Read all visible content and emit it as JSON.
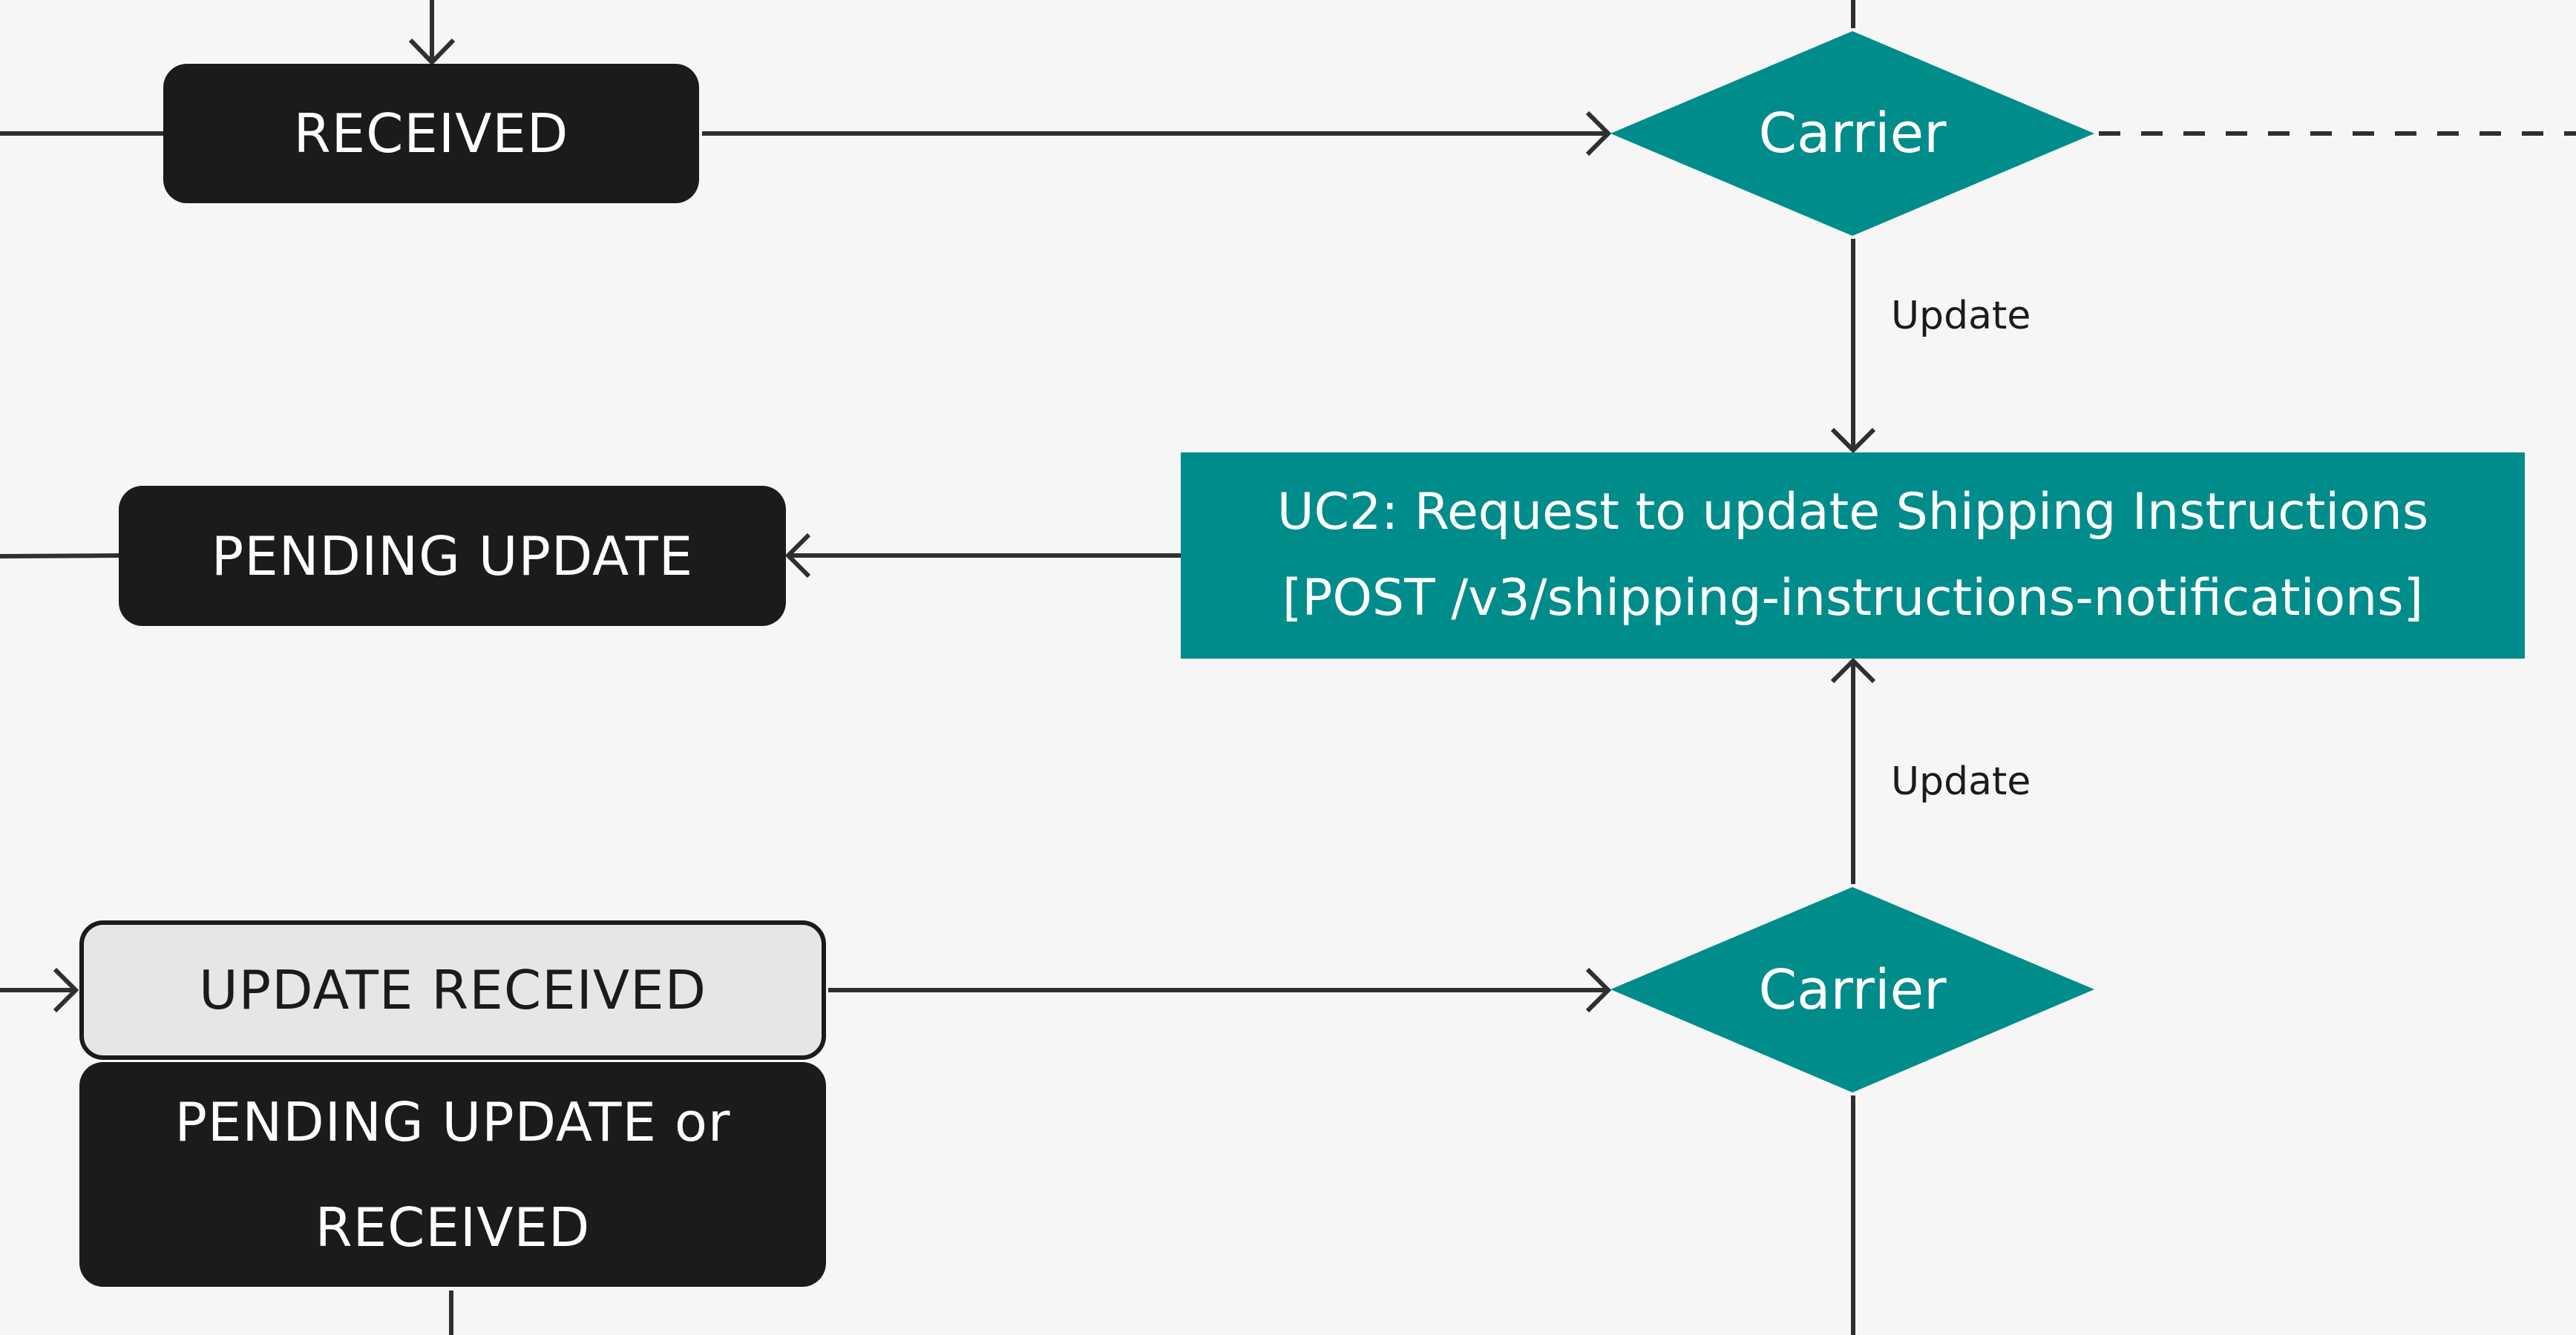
{
  "colors": {
    "background": "#f6f6f6",
    "state_dark": "#1b1b1b",
    "state_light": "#e6e6e6",
    "carrier_teal": "#008c8a",
    "connector": "#2f2f2f"
  },
  "states": {
    "received": {
      "label": "RECEIVED"
    },
    "pending_update": {
      "label": "PENDING UPDATE"
    },
    "update_received": {
      "label": "UPDATE RECEIVED"
    },
    "pending_update_or_received": {
      "line1": "PENDING UPDATE or",
      "line2": "RECEIVED"
    }
  },
  "decisions": {
    "carrier_top": {
      "label": "Carrier"
    },
    "carrier_bottom": {
      "label": "Carrier"
    }
  },
  "processes": {
    "uc2": {
      "line1": "UC2: Request to update Shipping Instructions",
      "line2": "[POST /v3/shipping-instructions-notifications]"
    }
  },
  "edge_labels": {
    "top_update": "Update",
    "bottom_update": "Update"
  }
}
